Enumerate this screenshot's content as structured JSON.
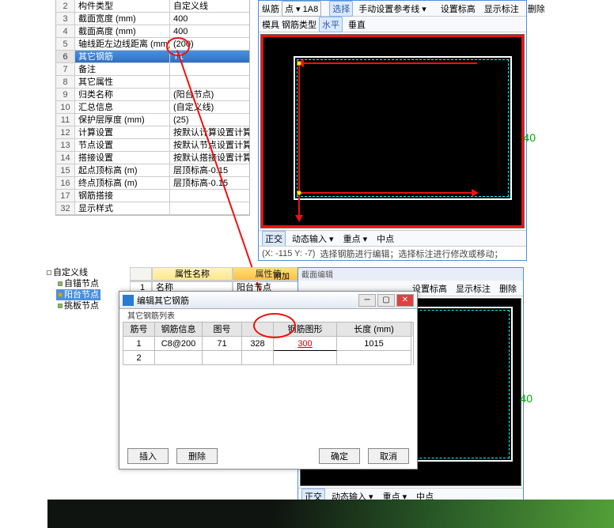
{
  "prop_rows": [
    {
      "idx": "2",
      "name": "构件类型",
      "val": "自定义线"
    },
    {
      "idx": "3",
      "name": "截面宽度 (mm)",
      "val": "400"
    },
    {
      "idx": "4",
      "name": "截面高度 (mm)",
      "val": "400"
    },
    {
      "idx": "5",
      "name": "轴线距左边线距离 (mm)",
      "val": "(200)"
    },
    {
      "idx": "6",
      "name": "其它钢筋",
      "val": "T1"
    },
    {
      "idx": "7",
      "name": "备注",
      "val": ""
    },
    {
      "idx": "8",
      "name": "其它属性",
      "val": ""
    },
    {
      "idx": "9",
      "name": "归类名称",
      "val": "(阳台节点)"
    },
    {
      "idx": "10",
      "name": "汇总信息",
      "val": "(自定义线)"
    },
    {
      "idx": "11",
      "name": "保护层厚度 (mm)",
      "val": "(25)"
    },
    {
      "idx": "12",
      "name": "计算设置",
      "val": "按默认计算设置计算"
    },
    {
      "idx": "13",
      "name": "节点设置",
      "val": "按默认节点设置计算"
    },
    {
      "idx": "14",
      "name": "搭接设置",
      "val": "按默认搭接设置计算"
    },
    {
      "idx": "15",
      "name": "起点顶标高 (m)",
      "val": "层顶标高-0.15"
    },
    {
      "idx": "16",
      "name": "终点顶标高 (m)",
      "val": "层顶标高-0.15"
    },
    {
      "idx": "17",
      "name": "钢筋搭接",
      "val": ""
    },
    {
      "idx": "32",
      "name": "显示样式",
      "val": ""
    }
  ],
  "toolbar_top": {
    "l1": "纵筋",
    "combo": "点 ▾ 1A8",
    "sel": "选择",
    "tip": "手动设置参考线 ▾",
    "b1": "设置标高",
    "b2": "显示标注",
    "b3": "删除",
    "l2": "模具",
    "l3": "钢筋类型",
    "opt1": "水平",
    "opt2": "垂直"
  },
  "dim": "40",
  "bbar": {
    "b1": "正交",
    "b2": "动态输入 ▾",
    "b3": "重点 ▾",
    "b4": "中点"
  },
  "status": {
    "coord": "(X: -115 Y: -7)",
    "tip": "选择钢筋进行编辑；选择标注进行修改或移动；"
  },
  "tree": {
    "root": "自定义线",
    "n1": "自锚节点",
    "n2": "阳台节点",
    "n3": "挑板节点"
  },
  "hdr2": {
    "name": "属性名称",
    "val": "属性值",
    "add": "附加",
    "row1": "1",
    "rv": "名称",
    "rvv": "阳台节点"
  },
  "panel2_title": "截面编辑",
  "dlg": {
    "title": "编辑其它钢筋",
    "sub": "其它钢筋列表",
    "cols": [
      "筋号",
      "钢筋信息",
      "图号",
      "",
      "钢筋图形",
      "长度 (mm)"
    ],
    "row": [
      "1",
      "C8@200",
      "71",
      "328",
      "",
      "1015"
    ],
    "val4": "300",
    "btn_ins": "插入",
    "btn_del": "删除",
    "btn_ok": "确定",
    "btn_cancel": "取消"
  },
  "panel2_tb": {
    "b1": "设置标高",
    "b2": "显示标注",
    "b3": "删除"
  },
  "panel2_bb": {
    "b1": "正交",
    "b2": "动态输入 ▾",
    "b3": "重点 ▾",
    "b4": "中点"
  }
}
